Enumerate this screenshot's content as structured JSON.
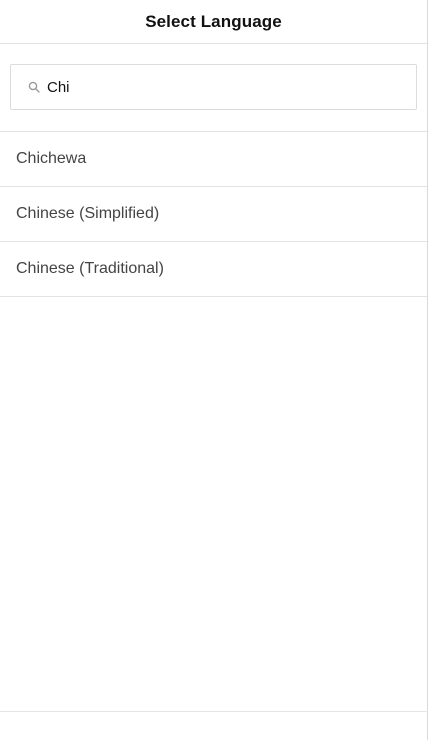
{
  "header": {
    "title": "Select Language"
  },
  "search": {
    "value": "Chi",
    "icon": "search-icon"
  },
  "languages": [
    {
      "label": "Chichewa"
    },
    {
      "label": "Chinese (Simplified)"
    },
    {
      "label": "Chinese (Traditional)"
    }
  ]
}
